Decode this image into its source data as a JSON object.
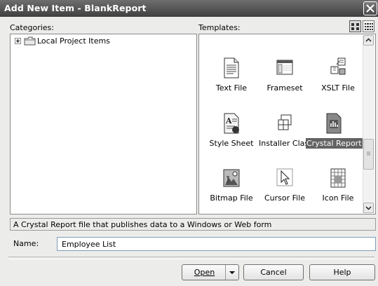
{
  "window": {
    "title": "Add New Item - BlankReport"
  },
  "categories": {
    "label": "Categories:",
    "items": [
      {
        "label": "Local Project Items",
        "expander": "+"
      }
    ]
  },
  "templates": {
    "label": "Templates:",
    "view_buttons": [
      "large-icons-view",
      "small-icons-view"
    ],
    "items": [
      {
        "label": "Text File",
        "icon": "text-file-icon"
      },
      {
        "label": "Frameset",
        "icon": "frameset-icon"
      },
      {
        "label": "XSLT File",
        "icon": "xslt-file-icon"
      },
      {
        "label": "Style Sheet",
        "icon": "style-sheet-icon"
      },
      {
        "label": "Installer Class",
        "icon": "installer-class-icon"
      },
      {
        "label": "Crystal Report",
        "icon": "crystal-report-icon",
        "selected": true
      },
      {
        "label": "Bitmap File",
        "icon": "bitmap-file-icon"
      },
      {
        "label": "Cursor File",
        "icon": "cursor-file-icon"
      },
      {
        "label": "Icon File",
        "icon": "icon-file-icon"
      }
    ]
  },
  "description": "A Crystal Report file that publishes data to a Windows or Web form",
  "name_field": {
    "label": "Name:",
    "value": "Employee List"
  },
  "buttons": {
    "open": "Open",
    "cancel": "Cancel",
    "help": "Help"
  },
  "colors": {
    "title_bar": "#4a4a4a",
    "dialog_bg": "#ececea",
    "selection": "#636363"
  }
}
